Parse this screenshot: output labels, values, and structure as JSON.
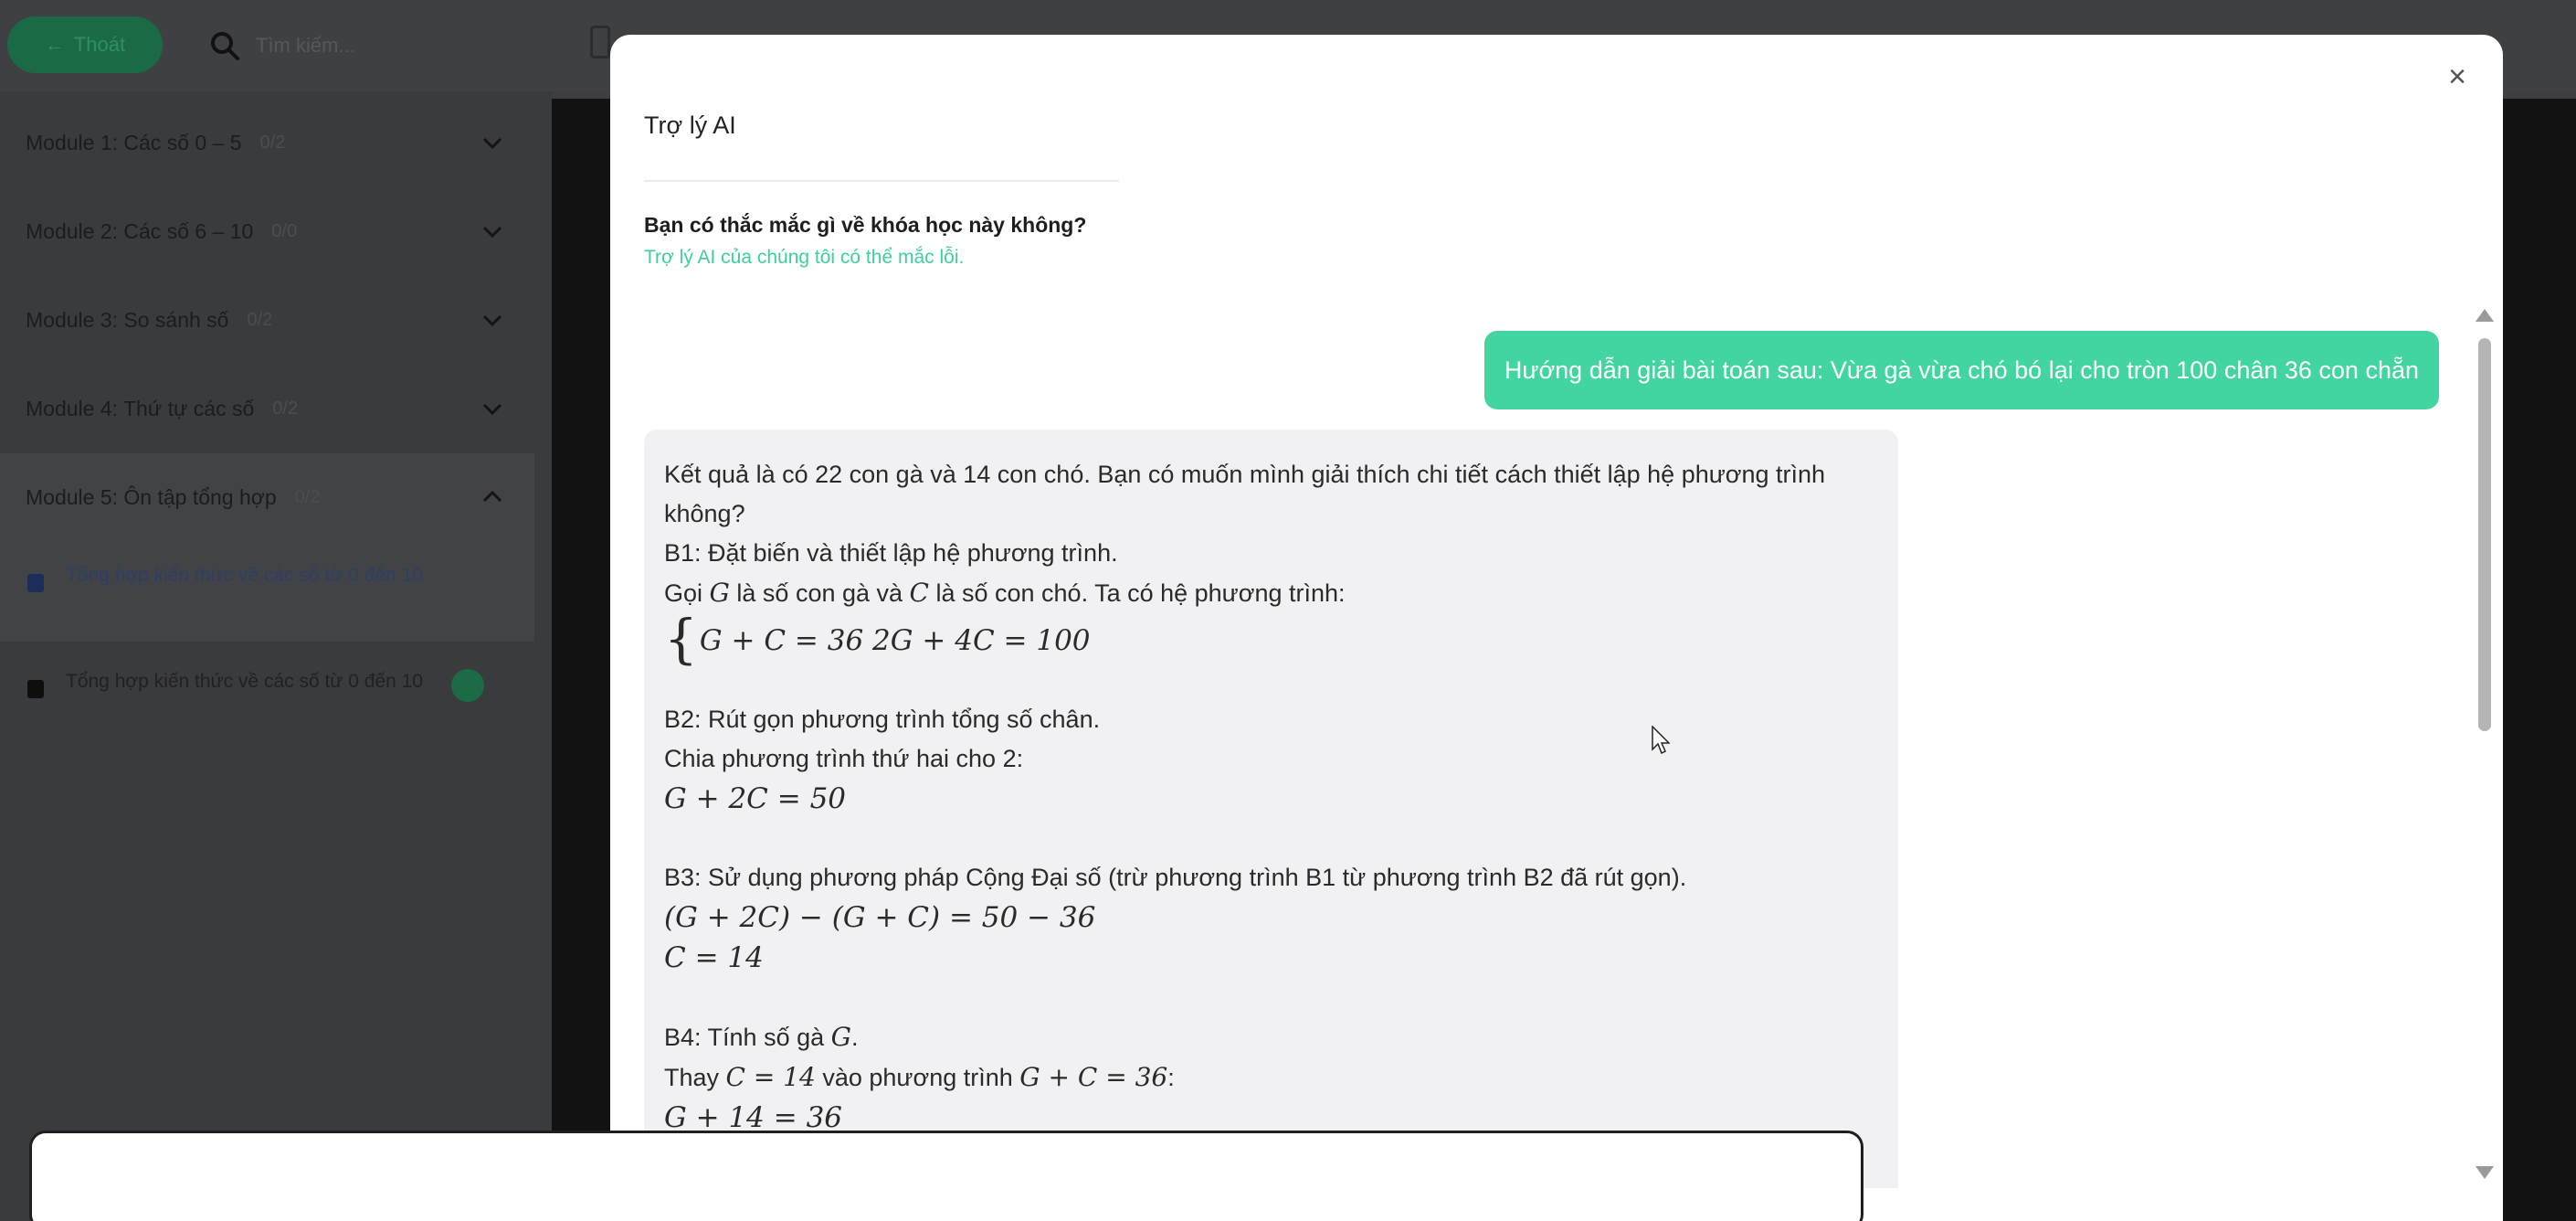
{
  "topbar": {
    "back_label": "Thoát",
    "search_placeholder": "Tìm kiếm..."
  },
  "sidebar": {
    "modules": [
      {
        "title": "Module 1: Các số 0 – 5",
        "count": "0/2"
      },
      {
        "title": "Module 2: Các số 6 – 10",
        "count": "0/0"
      },
      {
        "title": "Module 3: So sánh số",
        "count": "0/2"
      },
      {
        "title": "Module 4: Thứ tự các số",
        "count": "0/2"
      },
      {
        "title": "Module 5: Ôn tập tổng hợp",
        "count": "0/2"
      }
    ],
    "lessons": [
      {
        "title": "Tổng hợp kiến thức về các số từ 0 đến 10"
      },
      {
        "title": "Tổng hợp kiến thức về các số từ 0 đến 10"
      }
    ]
  },
  "modal": {
    "title": "Trợ lý AI",
    "close_icon": "×",
    "question": "Bạn có thắc mắc gì về khóa học này không?",
    "disclaimer": "Trợ lý AI của chúng tôi có thể mắc lỗi.",
    "user_message": "Hướng dẫn giải bài toán sau: Vừa gà vừa chó bó lại cho tròn 100 chân 36 con chẵn",
    "ai_message": {
      "intro": "Kết quả là có 22 con gà và 14 con chó. Bạn có muốn mình giải thích chi tiết cách thiết lập hệ phương trình không?",
      "b1_title": "B1: Đặt biến và thiết lập hệ phương trình.",
      "b1_text_a": "Gọi ",
      "var_g": "G",
      "b1_text_b": " là số con gà và ",
      "var_c": "C",
      "b1_text_c": " là số con chó. Ta có hệ phương trình:",
      "brace": "{",
      "system": "G + C = 36 2G + 4C = 100",
      "b2_title": "B2: Rút gọn phương trình tổng số chân.",
      "b2_text": "Chia phương trình thứ hai cho 2:",
      "b2_eq": "G + 2C = 50",
      "b3_title": "B3: Sử dụng phương pháp Cộng Đại số (trừ phương trình B1 từ phương trình B2 đã rút gọn).",
      "b3_eq1": "(G + 2C) − (G + C) = 50 − 36",
      "b3_eq2": "C = 14",
      "b4_title_a": "B4: Tính số gà ",
      "b4_title_var": "G",
      "b4_title_b": ".",
      "b4_text_a": "Thay ",
      "b4_inline1": "C = 14",
      "b4_text_b": " vào phương trình ",
      "b4_inline2": "G + C = 36",
      "b4_text_c": ":",
      "b4_eq": "G + 14 = 36"
    },
    "input_placeholder": ""
  },
  "colors": {
    "accent": "#43d5a0",
    "disclaimer": "#3fcf9c",
    "overlay": "#3d3e41",
    "ai_bubble": "#f1f1f3"
  }
}
